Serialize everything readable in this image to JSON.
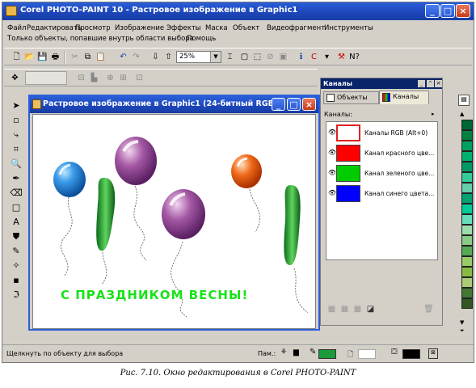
{
  "app": {
    "title": "Corel PHOTO-PAINT 10 - Растровое изображение в Graphic1"
  },
  "menu": {
    "row1": [
      "Файл",
      "Редактировать",
      "Просмотр",
      "Изображение",
      "Эффекты",
      "Маска",
      "Объект",
      "Видеофрагмент",
      "Инструменты"
    ],
    "row2": [
      "Только объекты, попавшие внутрь области выбора",
      "Помощь"
    ]
  },
  "toolbar": {
    "zoom_value": "25%"
  },
  "document": {
    "title": "Растровое изображение в Graphic1 (24-битный RGB)",
    "greeting": "С ПРАЗДНИКОМ ВЕСНЫ!"
  },
  "docker": {
    "title": "Каналы",
    "tabs": [
      "Объекты",
      "Каналы"
    ],
    "list_label": "Каналы:",
    "channels": [
      {
        "label": "Каналы RGB  (Alt+0)",
        "color": "#ffffff"
      },
      {
        "label": "Канал красного цве...",
        "color": "#ff0000"
      },
      {
        "label": "Канал зеленого цве...",
        "color": "#00cc00"
      },
      {
        "label": "Канал синего цвета...",
        "color": "#0000ff"
      }
    ]
  },
  "palette": [
    "#006633",
    "#008040",
    "#00a060",
    "#00b070",
    "#009966",
    "#33cc99",
    "#66ccaa",
    "#00a070",
    "#00cc99",
    "#66ddbb",
    "#99ddaa",
    "#88cc88",
    "#55aa55",
    "#99cc66",
    "#88bb44",
    "#aacc77",
    "#447733",
    "#335522"
  ],
  "status": {
    "hint": "Щелкнуть по объекту для выбора",
    "memory_label": "Пам.:",
    "fill_color": "#1a9a3a",
    "outline_color": "#000000"
  },
  "caption": "Рис. 7.10. Окно редактирования в Corel PHOTO-PAINT"
}
